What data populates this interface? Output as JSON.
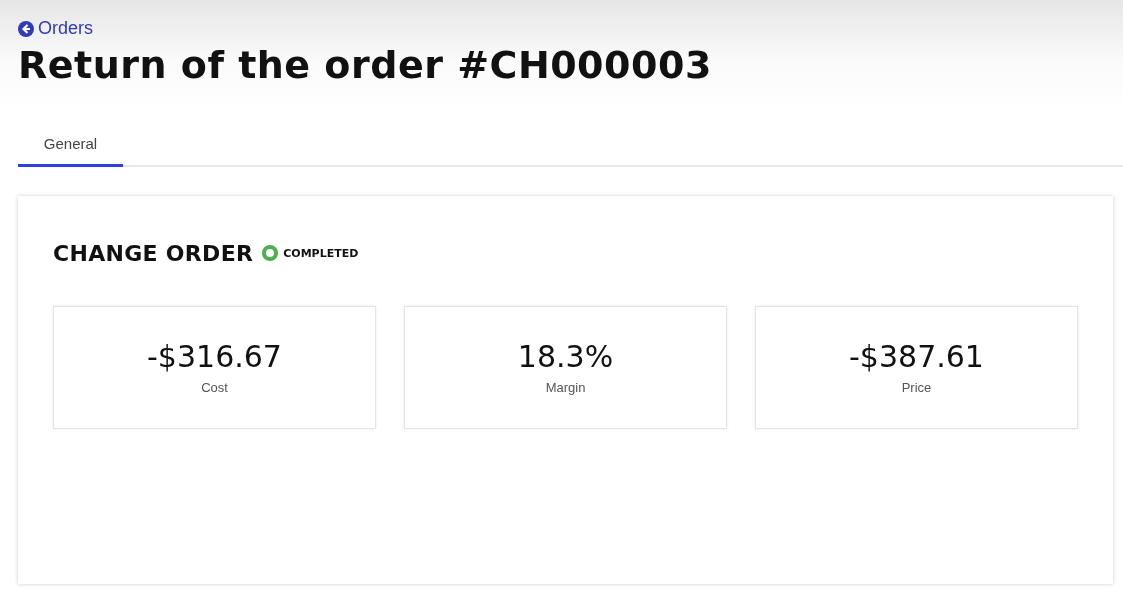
{
  "back_link": {
    "label": "Orders"
  },
  "title": "Return of the order #CH000003",
  "tabs": [
    {
      "label": "General",
      "selected": true
    }
  ],
  "card": {
    "heading": "CHANGE ORDER",
    "status": {
      "label": "COMPLETED",
      "color": "#4caf50"
    },
    "metrics": [
      {
        "value": "-$316.67",
        "label": "Cost"
      },
      {
        "value": "18.3%",
        "label": "Margin"
      },
      {
        "value": "-$387.61",
        "label": "Price"
      }
    ]
  }
}
